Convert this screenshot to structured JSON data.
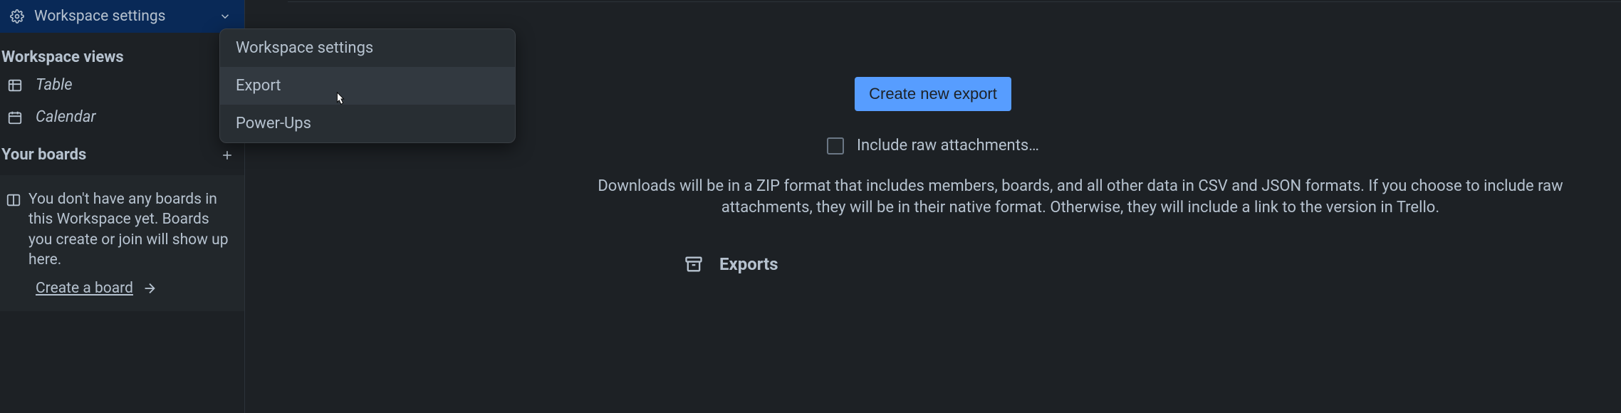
{
  "sidebar": {
    "workspace_settings_label": "Workspace settings",
    "views_heading": "Workspace views",
    "views": [
      {
        "label": "Table",
        "icon": "table-icon"
      },
      {
        "label": "Calendar",
        "icon": "calendar-icon"
      }
    ],
    "boards_heading": "Your boards",
    "empty_boards_text": "You don't have any boards in this Workspace yet. Boards you create or join will show up here.",
    "create_board_label": "Create a board"
  },
  "dropdown": {
    "items": [
      {
        "label": "Workspace settings"
      },
      {
        "label": "Export"
      },
      {
        "label": "Power-Ups"
      }
    ]
  },
  "main": {
    "create_export_label": "Create new export",
    "include_attachments_label": "Include raw attachments…",
    "description": "Downloads will be in a ZIP format that includes members, boards, and all other data in CSV and JSON formats. If you choose to include raw attachments, they will be in their native format. Otherwise, they will include a link to the version in Trello.",
    "exports_heading": "Exports"
  }
}
